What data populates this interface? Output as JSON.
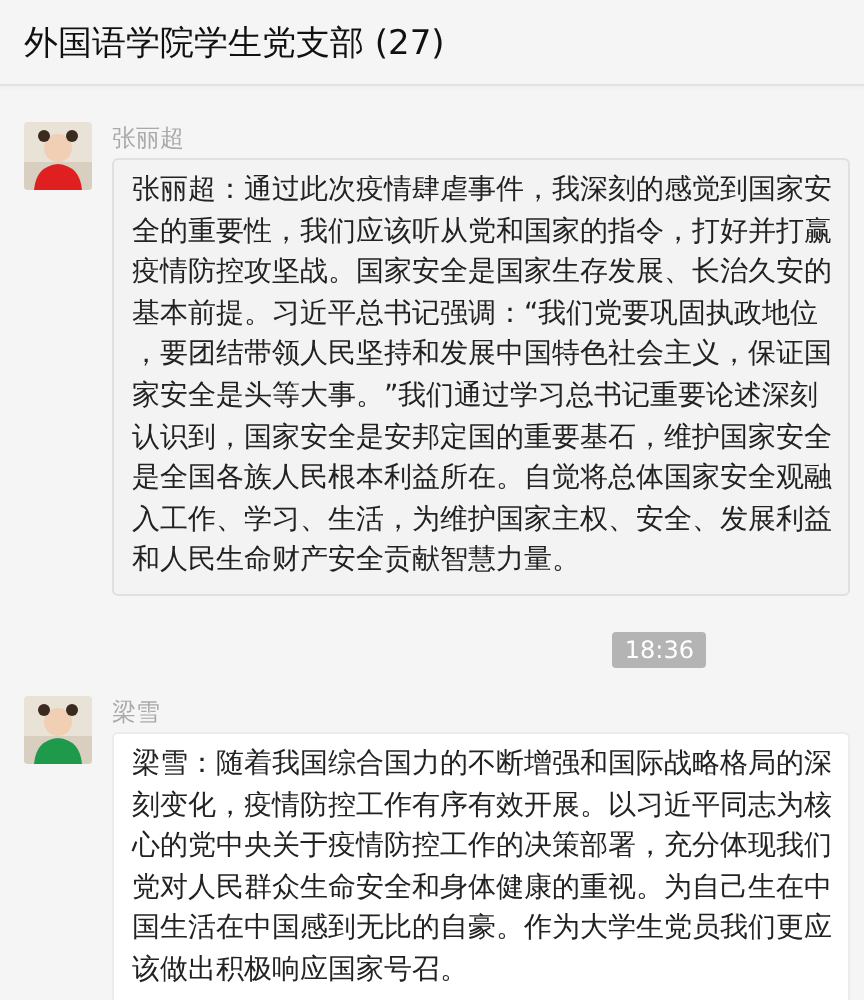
{
  "window": {
    "title": "外国语学院学生党支部 (27)"
  },
  "messages": [
    {
      "kind": "message",
      "sender": "张丽超",
      "highlighted": true,
      "text": "张丽超：通过此次疫情肆虐事件，我深刻的感觉到国家安全的重要性，我们应该听从党和国家的指令，打好并打赢疫情防控攻坚战。国家安全是国家生存发展、长治久安的基本前提。习近平总书记强调：“我们党要巩固执政地位，要团结带领人民坚持和发展中国特色社会主义，保证国家安全是头等大事。”我们通过学习总书记重要论述深刻认识到，国家安全是安邦定国的重要基石，维护国家安全是全国各族人民根本利益所在。自觉将总体国家安全观融入工作、学习、生活，为维护国家主权、安全、发展利益和人民生命财产安全贡献智慧力量。"
    },
    {
      "kind": "time",
      "text": "18:36"
    },
    {
      "kind": "message",
      "sender": "梁雪",
      "highlighted": false,
      "text": "梁雪：随着我国综合国力的不断增强和国际战略格局的深刻变化，疫情防控工作有序有效开展。以习近平同志为核心的党中央关于疫情防控工作的决策部署，充分体现我们党对人民群众生命安全和身体健康的重视。为自己生在中国生活在中国感到无比的自豪。作为大学生党员我们更应该做出积极响应国家号召。"
    }
  ]
}
